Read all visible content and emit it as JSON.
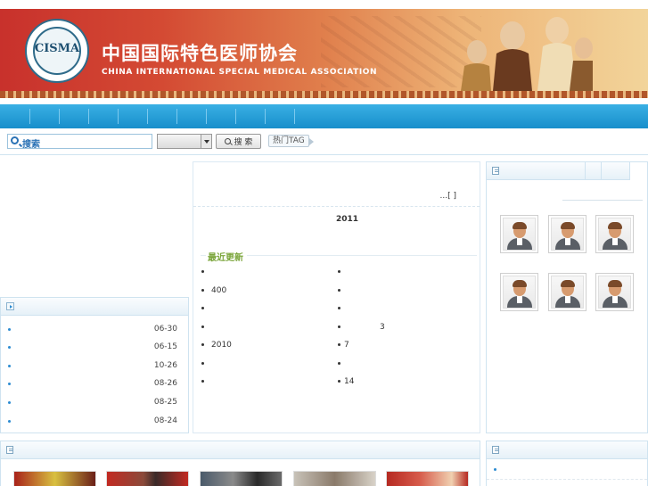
{
  "banner": {
    "title": "中国国际特色医师协会",
    "subtitle": "CHINA INTERNATIONAL SPECIAL MEDICAL ASSOCIATION",
    "logo_text": "CISMA"
  },
  "search": {
    "label": "搜索",
    "button_label": "搜 索",
    "hot_tag_label": "热门TAG"
  },
  "left_list": {
    "dates": [
      "06-30",
      "06-15",
      "10-26",
      "08-26",
      "08-25",
      "08-24"
    ]
  },
  "center": {
    "more_link": "...[ ]",
    "year": "2011",
    "recent_title": "最近更新",
    "left_items": [
      "",
      "400",
      "",
      "",
      "2010",
      "",
      ""
    ],
    "right_items": [
      "",
      "",
      "",
      "3",
      "7",
      "",
      "14"
    ]
  },
  "colors": {
    "nav_blue": "#1f9bd8",
    "banner_red": "#c8312c",
    "accent_green": "#7aa53a",
    "link_blue": "#2a72b5"
  }
}
